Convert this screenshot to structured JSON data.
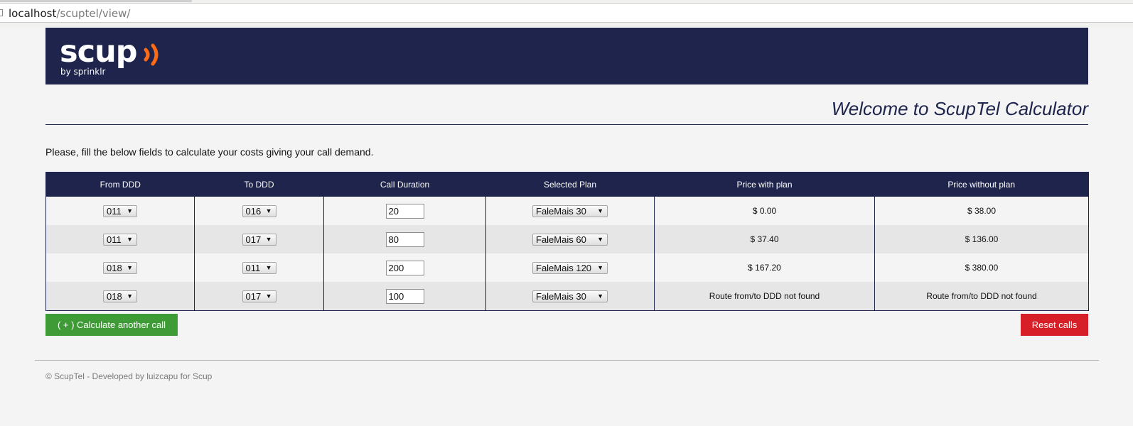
{
  "browser": {
    "url_host": "localhost",
    "url_path": "/scuptel/view/"
  },
  "header": {
    "logo_text": "scup",
    "logo_subtext": "by sprinklr",
    "logo_icon": "orange-sound-waves"
  },
  "title": "Welcome to ScupTel Calculator",
  "intro": "Please, fill the below fields to calculate your costs giving your call demand.",
  "table": {
    "headers": [
      "From DDD",
      "To DDD",
      "Call Duration",
      "Selected Plan",
      "Price with plan",
      "Price without plan"
    ],
    "rows": [
      {
        "from": "011",
        "to": "016",
        "duration": "20",
        "plan": "FaleMais 30",
        "price_with": "$ 0.00",
        "price_without": "$ 38.00"
      },
      {
        "from": "011",
        "to": "017",
        "duration": "80",
        "plan": "FaleMais 60",
        "price_with": "$ 37.40",
        "price_without": "$ 136.00"
      },
      {
        "from": "018",
        "to": "011",
        "duration": "200",
        "plan": "FaleMais 120",
        "price_with": "$ 167.20",
        "price_without": "$ 380.00"
      },
      {
        "from": "018",
        "to": "017",
        "duration": "100",
        "plan": "FaleMais 30",
        "price_with": "Route from/to DDD not found",
        "price_without": "Route from/to DDD not found"
      }
    ]
  },
  "buttons": {
    "add": "( + ) Calculate another call",
    "reset": "Reset calls"
  },
  "footer": "© ScupTel - Developed by luizcapu for Scup",
  "colors": {
    "navy": "#1e244b",
    "orange": "#ff6a13",
    "green": "#3e9b35",
    "red": "#d61f26"
  }
}
